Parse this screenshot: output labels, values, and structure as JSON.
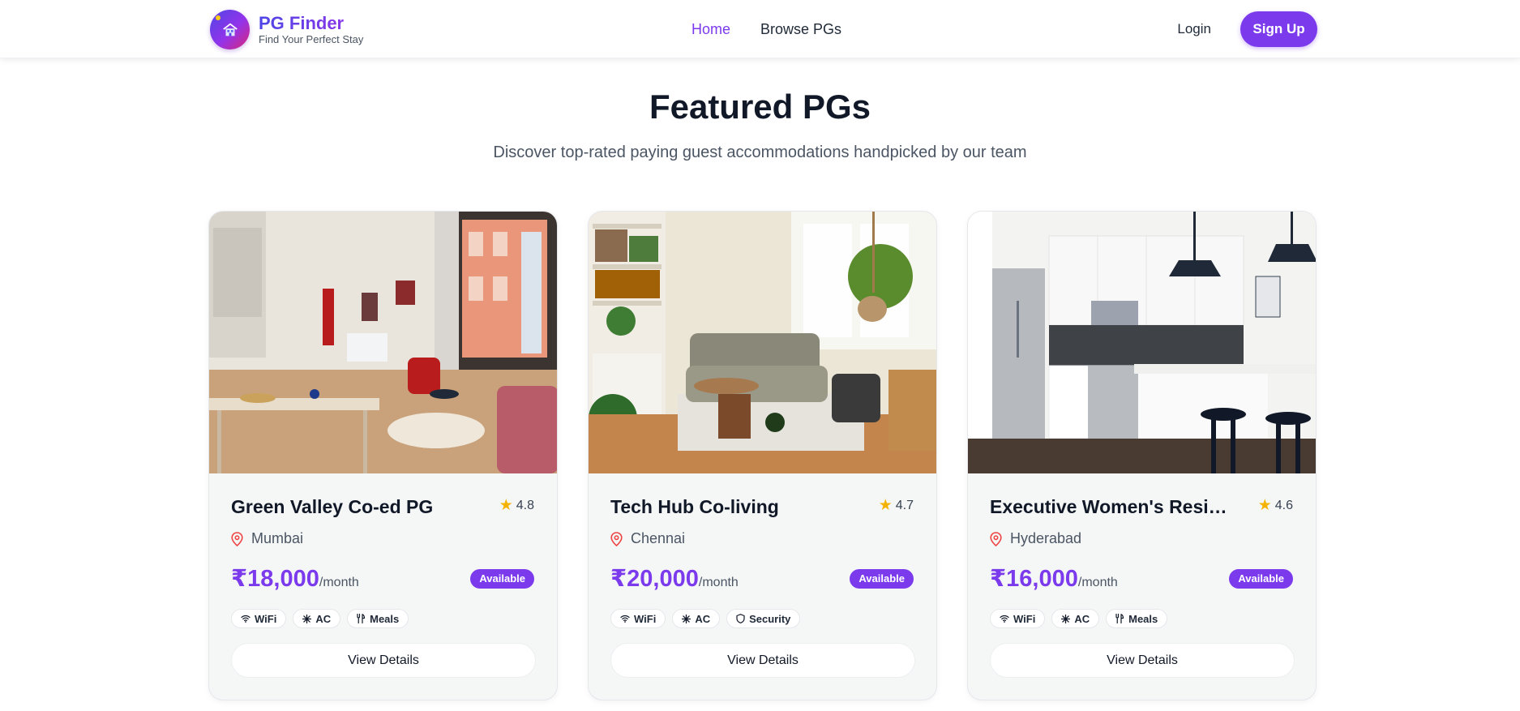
{
  "brand": {
    "name": "PG Finder",
    "tagline": "Find Your Perfect Stay"
  },
  "nav": {
    "home": "Home",
    "browse": "Browse PGs"
  },
  "auth": {
    "login": "Login",
    "signup": "Sign Up"
  },
  "hero": {
    "title": "Featured PGs",
    "subtitle": "Discover top-rated paying guest accommodations handpicked by our team"
  },
  "colors": {
    "accent": "#7c3aed",
    "star": "#f5b301",
    "location_pin": "#ef4444"
  },
  "cards": [
    {
      "name": "Green Valley Co-ed PG",
      "rating": "4.8",
      "location": "Mumbai",
      "price": "₹18,000",
      "price_unit": "/month",
      "status": "Available",
      "amenities": [
        {
          "label": "WiFi",
          "icon": "wifi-icon"
        },
        {
          "label": "AC",
          "icon": "snowflake-icon"
        },
        {
          "label": "Meals",
          "icon": "utensils-icon"
        }
      ],
      "button": "View Details"
    },
    {
      "name": "Tech Hub Co-living",
      "rating": "4.7",
      "location": "Chennai",
      "price": "₹20,000",
      "price_unit": "/month",
      "status": "Available",
      "amenities": [
        {
          "label": "WiFi",
          "icon": "wifi-icon"
        },
        {
          "label": "AC",
          "icon": "snowflake-icon"
        },
        {
          "label": "Security",
          "icon": "shield-icon"
        }
      ],
      "button": "View Details"
    },
    {
      "name": "Executive Women's Residence",
      "rating": "4.6",
      "location": "Hyderabad",
      "price": "₹16,000",
      "price_unit": "/month",
      "status": "Available",
      "amenities": [
        {
          "label": "WiFi",
          "icon": "wifi-icon"
        },
        {
          "label": "AC",
          "icon": "snowflake-icon"
        },
        {
          "label": "Meals",
          "icon": "utensils-icon"
        }
      ],
      "button": "View Details"
    }
  ]
}
